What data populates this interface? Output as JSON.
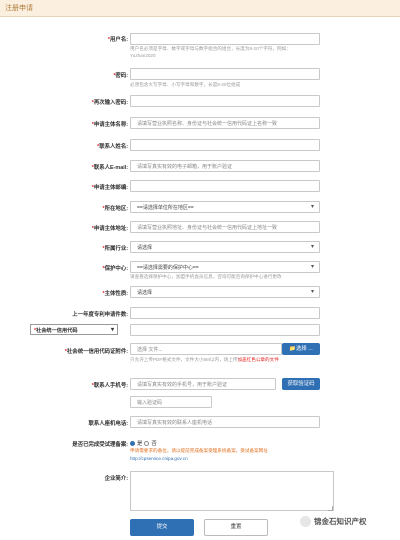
{
  "header": {
    "title": "注册申请"
  },
  "form": {
    "username": {
      "label": "用户名:",
      "hint_1": "用户名必须是字母、数字或字母与数字组合的组合，长度为8-20个字符，例如：",
      "hint_2": "Yuzhan2020"
    },
    "password": {
      "label": "密码:",
      "hint": "必须包含大写字母、小写字母和数字，长度8-20位组成"
    },
    "confirm_password": {
      "label": "再次输入密码:"
    },
    "applicant_name": {
      "label": "申请主体名称:",
      "placeholder": "请填写营业执照名称、身份证与社会统一信用代码证上名称一致"
    },
    "contact_name": {
      "label": "联系人姓名:"
    },
    "contact_email": {
      "label": "联系人E-mail:",
      "placeholder": "请填写真实有效的电子邮箱，用于账户验证"
    },
    "postal_code": {
      "label": "申请主体邮编:"
    },
    "region": {
      "label": "所在地区:",
      "placeholder": "==请选择单位所在地区=="
    },
    "address": {
      "label": "申请主体地址:",
      "placeholder": "请填写营业执照地址、身份证与社会统一信用代码证上地址一致"
    },
    "industry": {
      "label": "所属行业:",
      "placeholder": "请选择"
    },
    "protection_center": {
      "label": "保护中心:",
      "placeholder": "==请选择需要的保护中心==",
      "hint": "请查看选择保护中心，加盟手机会员信息，咨询可能咨询保护中心进行更改"
    },
    "entity_type": {
      "label": "主体性质:",
      "placeholder": "请选择"
    },
    "prior_patents": {
      "label": "上一年度专利申请件数:"
    },
    "credit_code": {
      "label": "社会统一信用代码:",
      "select_label": "社会统一信用代码"
    },
    "credit_attachment": {
      "label": "社会统一信用代码证附件:",
      "placeholder": "选择 文件...",
      "button": "选择 ...",
      "hint_prefix": "只允许上传PDF格式文件，文件大小5M以内，请上传",
      "hint_emphasis": "加盖红色公章的文件"
    },
    "contact_phone": {
      "label": "联系人手机号:",
      "placeholder": "请填写真实有效的手机号，用于账户验证",
      "button": "获取验证码"
    },
    "verification_code": {
      "placeholder": "输入验证码"
    },
    "landline": {
      "label": "联系人座机电话:",
      "placeholder": "请填写真实有效的联系人座机电话"
    },
    "registered_trust": {
      "label": "是否已完成受试理备案:",
      "options": [
        "是",
        "否"
      ],
      "note_1": "申请需要求的备位，请以提前完成备案受理系统备案，受试备案网址",
      "note_2": "http://cpservice.cnipa.gov.cn"
    },
    "intro": {
      "label": "企业简介:"
    }
  },
  "actions": {
    "submit": "提交",
    "reset": "重置"
  },
  "watermark": {
    "text": "锦金石知识产权"
  },
  "colors": {
    "accent": "#2f6fb3",
    "header_bg": "#fbf0e0",
    "required": "#e02020"
  }
}
